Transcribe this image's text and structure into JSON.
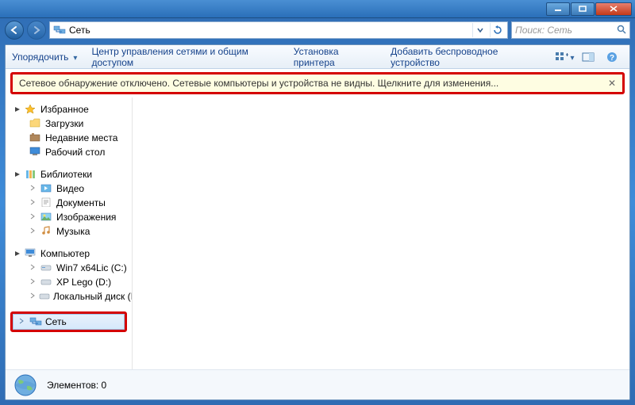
{
  "window": {
    "min_tip": "Minimize",
    "max_tip": "Maximize",
    "close_tip": "Close"
  },
  "nav": {
    "location": "Сеть",
    "search_placeholder": "Поиск: Сеть"
  },
  "toolbar": {
    "organize": "Упорядочить",
    "items": [
      "Центр управления сетями и общим доступом",
      "Установка принтера",
      "Добавить беспроводное устройство"
    ]
  },
  "notice": {
    "text": "Сетевое обнаружение отключено. Сетевые компьютеры и устройства не видны. Щелкните для изменения..."
  },
  "sidebar": {
    "favorites": {
      "label": "Избранное",
      "items": [
        "Загрузки",
        "Недавние места",
        "Рабочий стол"
      ]
    },
    "libraries": {
      "label": "Библиотеки",
      "items": [
        "Видео",
        "Документы",
        "Изображения",
        "Музыка"
      ]
    },
    "computer": {
      "label": "Компьютер",
      "items": [
        "Win7 x64Lic (C:)",
        "XP Lego (D:)",
        "Локальный диск (I"
      ]
    },
    "network": {
      "label": "Сеть"
    }
  },
  "status": {
    "text": "Элементов: 0"
  },
  "icons": {
    "back": "back-icon",
    "forward": "forward-icon",
    "chevron_down": "chevron-down-icon",
    "refresh": "refresh-icon",
    "search": "search-icon",
    "views": "views-icon",
    "preview": "preview-pane-icon",
    "help": "help-icon",
    "close_x": "close-icon",
    "star": "star-icon",
    "folder": "folder-icon",
    "recent": "recent-places-icon",
    "desktop": "desktop-icon",
    "library": "library-icon",
    "video": "video-library-icon",
    "documents": "documents-library-icon",
    "pictures": "pictures-library-icon",
    "music": "music-library-icon",
    "computer": "computer-icon",
    "disk": "disk-icon",
    "drive": "drive-icon",
    "network": "network-icon",
    "globe": "globe-icon"
  }
}
